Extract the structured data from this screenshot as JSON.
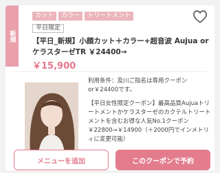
{
  "coupon": {
    "ribbon_label": "新規",
    "tags": [
      "カット",
      "カラー",
      "トリートメント"
    ],
    "limit_badge": "平日限定",
    "title": "【平日_新規】小顔カット＋カラー+超音波 Aujua or ケラスターゼTR ￥24400→",
    "price": "￥15,900",
    "conditions_line": "利用条件：及川ご指名は専用クーポンor￥24400です。",
    "description": "【平日女性限定クーポン】最高品質Aujuaトリートメントかケラスターゼのカクテルトリートメントを含むお得な人気No.1クーポン￥22800→￥14900（＋2000円でインメトリィに変更可能）",
    "favorite_icon": "heart-outline-icon"
  },
  "actions": {
    "add_menu_label": "メニューを追加",
    "book_label": "このクーポンで予約"
  },
  "colors": {
    "accent": "#e37d8e",
    "tag_bg": "#ebb5bb",
    "ribbon_bg": "#e9a0aa"
  }
}
